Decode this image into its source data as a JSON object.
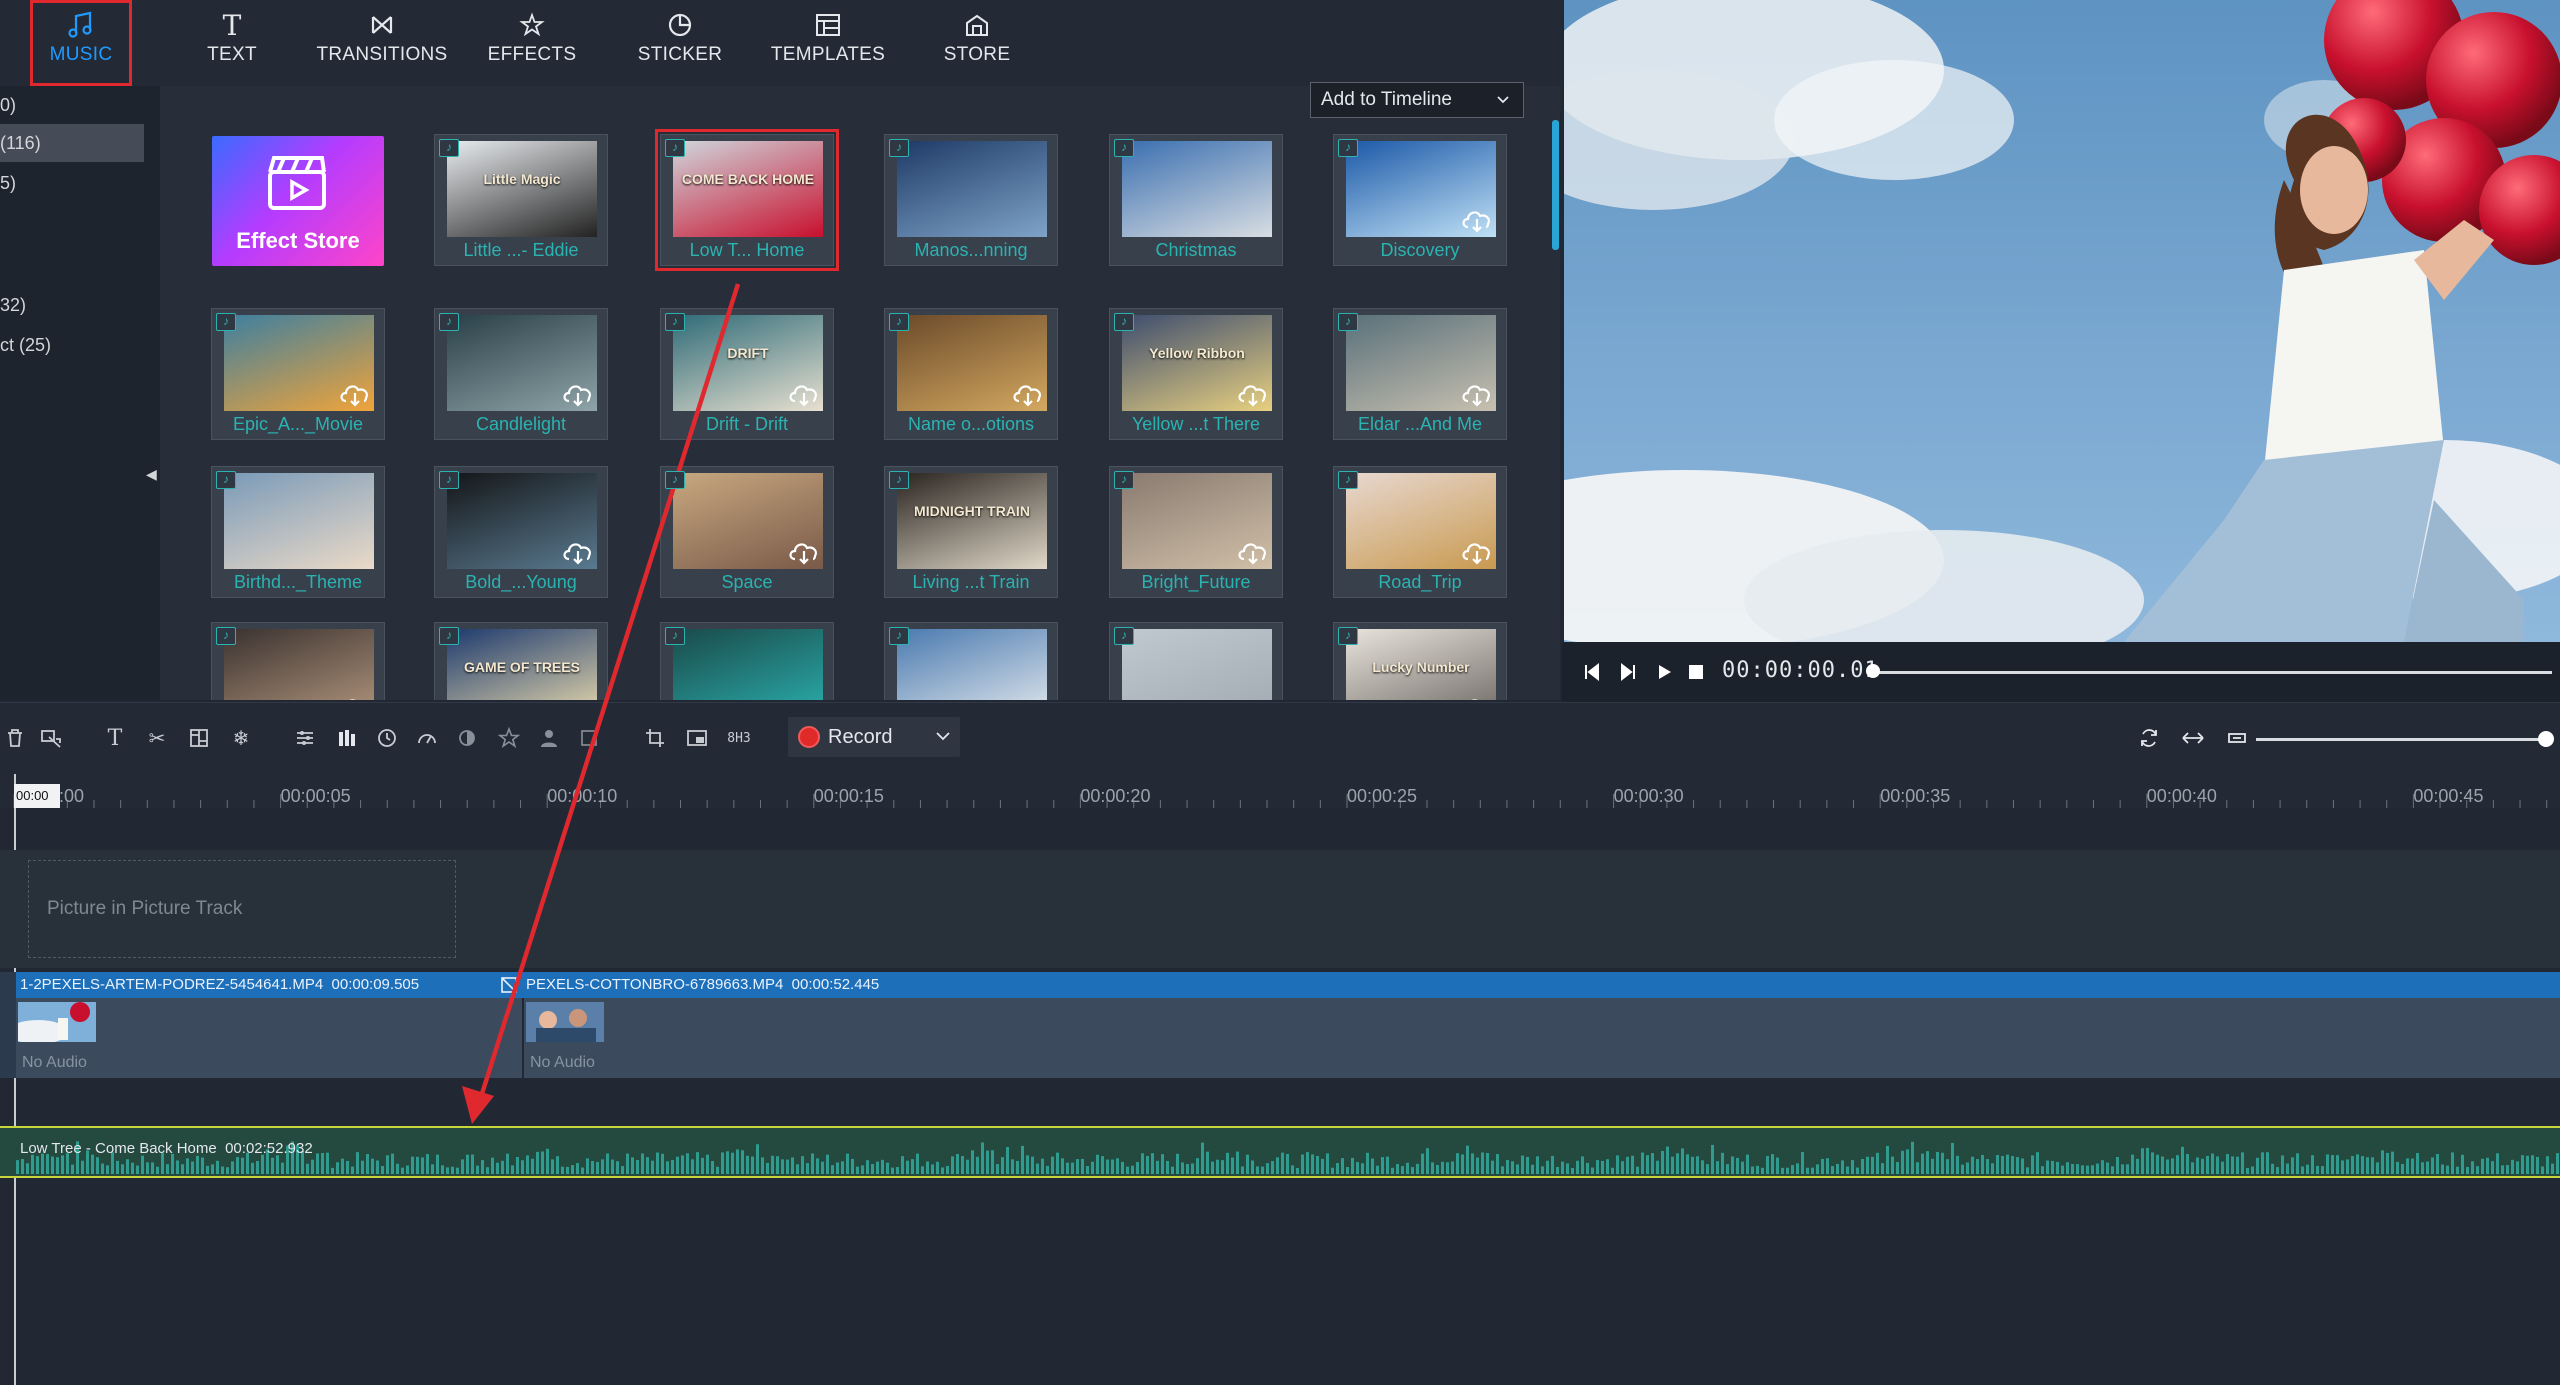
{
  "tabs": [
    {
      "label": "MUSIC",
      "icon": "music-note-icon",
      "active": true
    },
    {
      "label": "TEXT",
      "icon": "text-icon",
      "active": false
    },
    {
      "label": "TRANSITIONS",
      "icon": "transitions-icon",
      "active": false
    },
    {
      "label": "EFFECTS",
      "icon": "effects-icon",
      "active": false
    },
    {
      "label": "STICKER",
      "icon": "sticker-icon",
      "active": false
    },
    {
      "label": "TEMPLATES",
      "icon": "templates-icon",
      "active": false
    },
    {
      "label": "STORE",
      "icon": "store-icon",
      "active": false
    }
  ],
  "sidebar": {
    "items": [
      {
        "label": "0)"
      },
      {
        "label": "(116)",
        "selected": true
      },
      {
        "label": "5)"
      },
      {
        "label": "32)"
      },
      {
        "label": "ct (25)"
      }
    ]
  },
  "add_to_timeline": {
    "label": "Add to Timeline"
  },
  "media": {
    "store_label": "Effect Store",
    "items": [
      {
        "name": "Little ...- Eddie",
        "thumb_text": "Little Magic",
        "cloud": false
      },
      {
        "name": "Low T... Home",
        "thumb_text": "COME BACK HOME",
        "cloud": false,
        "highlighted": true
      },
      {
        "name": "Manos...nning",
        "cloud": false
      },
      {
        "name": "Christmas",
        "cloud": false
      },
      {
        "name": "Discovery",
        "cloud": true
      },
      {
        "name": "Epic_A..._Movie",
        "cloud": true
      },
      {
        "name": "Candlelight",
        "cloud": true
      },
      {
        "name": "Drift - Drift",
        "thumb_text": "DRIFT",
        "cloud": true
      },
      {
        "name": "Name o...otions",
        "cloud": true
      },
      {
        "name": "Yellow ...t There",
        "thumb_text": "Yellow Ribbon",
        "cloud": true
      },
      {
        "name": "Eldar ...And Me",
        "cloud": true
      },
      {
        "name": "Birthd..._Theme",
        "cloud": false
      },
      {
        "name": "Bold_...Young",
        "cloud": true
      },
      {
        "name": "Space",
        "cloud": true
      },
      {
        "name": "Living ...t Train",
        "thumb_text": "MIDNIGHT TRAIN",
        "cloud": false
      },
      {
        "name": "Bright_Future",
        "cloud": true
      },
      {
        "name": "Road_Trip",
        "cloud": true
      },
      {
        "name": "",
        "cloud": true
      },
      {
        "name": "",
        "thumb_text": "GAME OF TREES",
        "cloud": false
      },
      {
        "name": "",
        "cloud": false
      },
      {
        "name": "",
        "cloud": false
      },
      {
        "name": "",
        "cloud": false
      },
      {
        "name": "",
        "thumb_text": "Lucky Number",
        "cloud": true
      }
    ]
  },
  "player": {
    "timecode": "00:00:00.01"
  },
  "toolbar": {
    "record_label": "Record"
  },
  "ruler": {
    "ticks": [
      "00:00:00",
      "00:00:05",
      "00:00:10",
      "00:00:15",
      "00:00:20",
      "00:00:25",
      "00:00:30",
      "00:00:35",
      "00:00:40",
      "00:00:45"
    ],
    "playhead_label": "00:00"
  },
  "tracks": {
    "pip_placeholder": "Picture in Picture Track",
    "video_clips": [
      {
        "name": "1-2PEXELS-ARTEM-PODREZ-5454641.MP4",
        "duration": "00:00:09.505",
        "audio": "No Audio"
      },
      {
        "name": "PEXELS-COTTONBRO-6789663.MP4",
        "duration": "00:00:52.445",
        "audio": "No Audio"
      }
    ],
    "audio_clip": {
      "name": "Low Tree - Come Back Home",
      "duration": "00:02:52.932"
    }
  },
  "colors": {
    "accent": "#1f9bff",
    "highlight": "#e0282f",
    "teal": "#2bb3b1",
    "clip_blue": "#1c6fb8",
    "wave": "#2f9c8f"
  }
}
